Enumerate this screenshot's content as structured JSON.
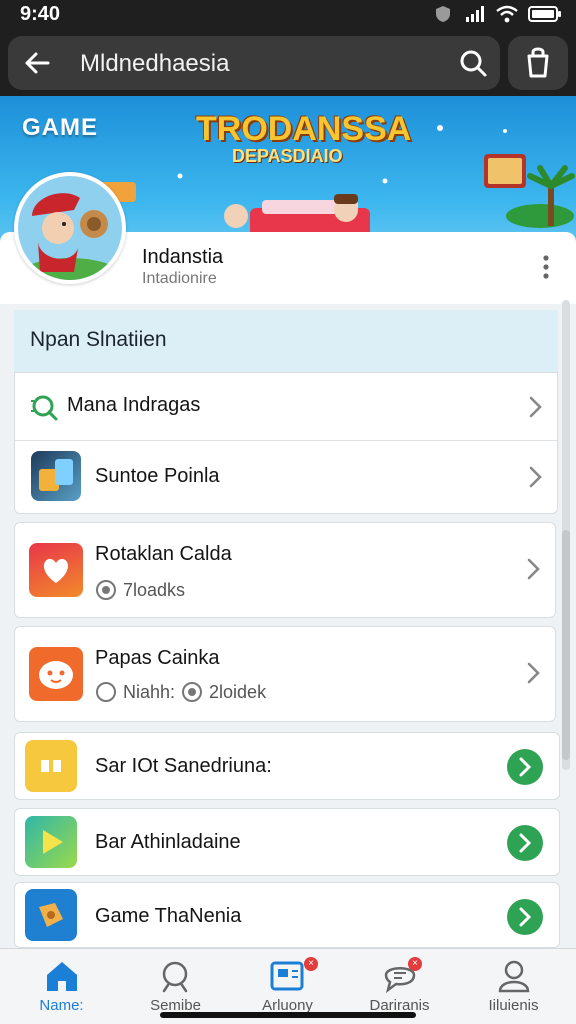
{
  "status_bar": {
    "time": "9:40"
  },
  "header": {
    "title": "Mldnedhaesia"
  },
  "banner": {
    "label": "GAME",
    "title_line1": "TRODANSSA",
    "title_line2": "DEPASDIAIO"
  },
  "profile": {
    "name": "Indanstia",
    "subtitle": "Intadionire"
  },
  "section": {
    "title": "Npan Slnatiien"
  },
  "rows": [
    {
      "title": "Mana Indragas",
      "icon": "search-icon"
    },
    {
      "title": "Suntoe Poinla",
      "icon": "game-app-icon"
    }
  ],
  "cards": [
    {
      "title": "Rotaklan Calda",
      "sub_value": "7loadks",
      "icon": "heart-app-icon"
    },
    {
      "title": "Papas Cainka",
      "sub_value1": "Niahh:",
      "sub_value2": "2loidek",
      "icon": "face-app-icon"
    }
  ],
  "list": [
    {
      "title": "Sar IOt Sanedriuna:",
      "icon": "pause-app-icon"
    },
    {
      "title": "Bar Athinladaine",
      "icon": "play-app-icon"
    },
    {
      "title": "Game ThaNenia",
      "icon": "puzzle-app-icon"
    }
  ],
  "tabs": [
    {
      "label": "Name:",
      "icon": "home-icon",
      "active": true
    },
    {
      "label": "Semibe",
      "icon": "search-icon"
    },
    {
      "label": "Arluony",
      "icon": "activity-icon"
    },
    {
      "label": "Dariranis",
      "icon": "chat-icon"
    },
    {
      "label": "Iiluienis",
      "icon": "profile-icon"
    }
  ],
  "colors": {
    "accent": "#1b7fd6",
    "go_green": "#2fa354",
    "section_bg": "#dceef6"
  }
}
